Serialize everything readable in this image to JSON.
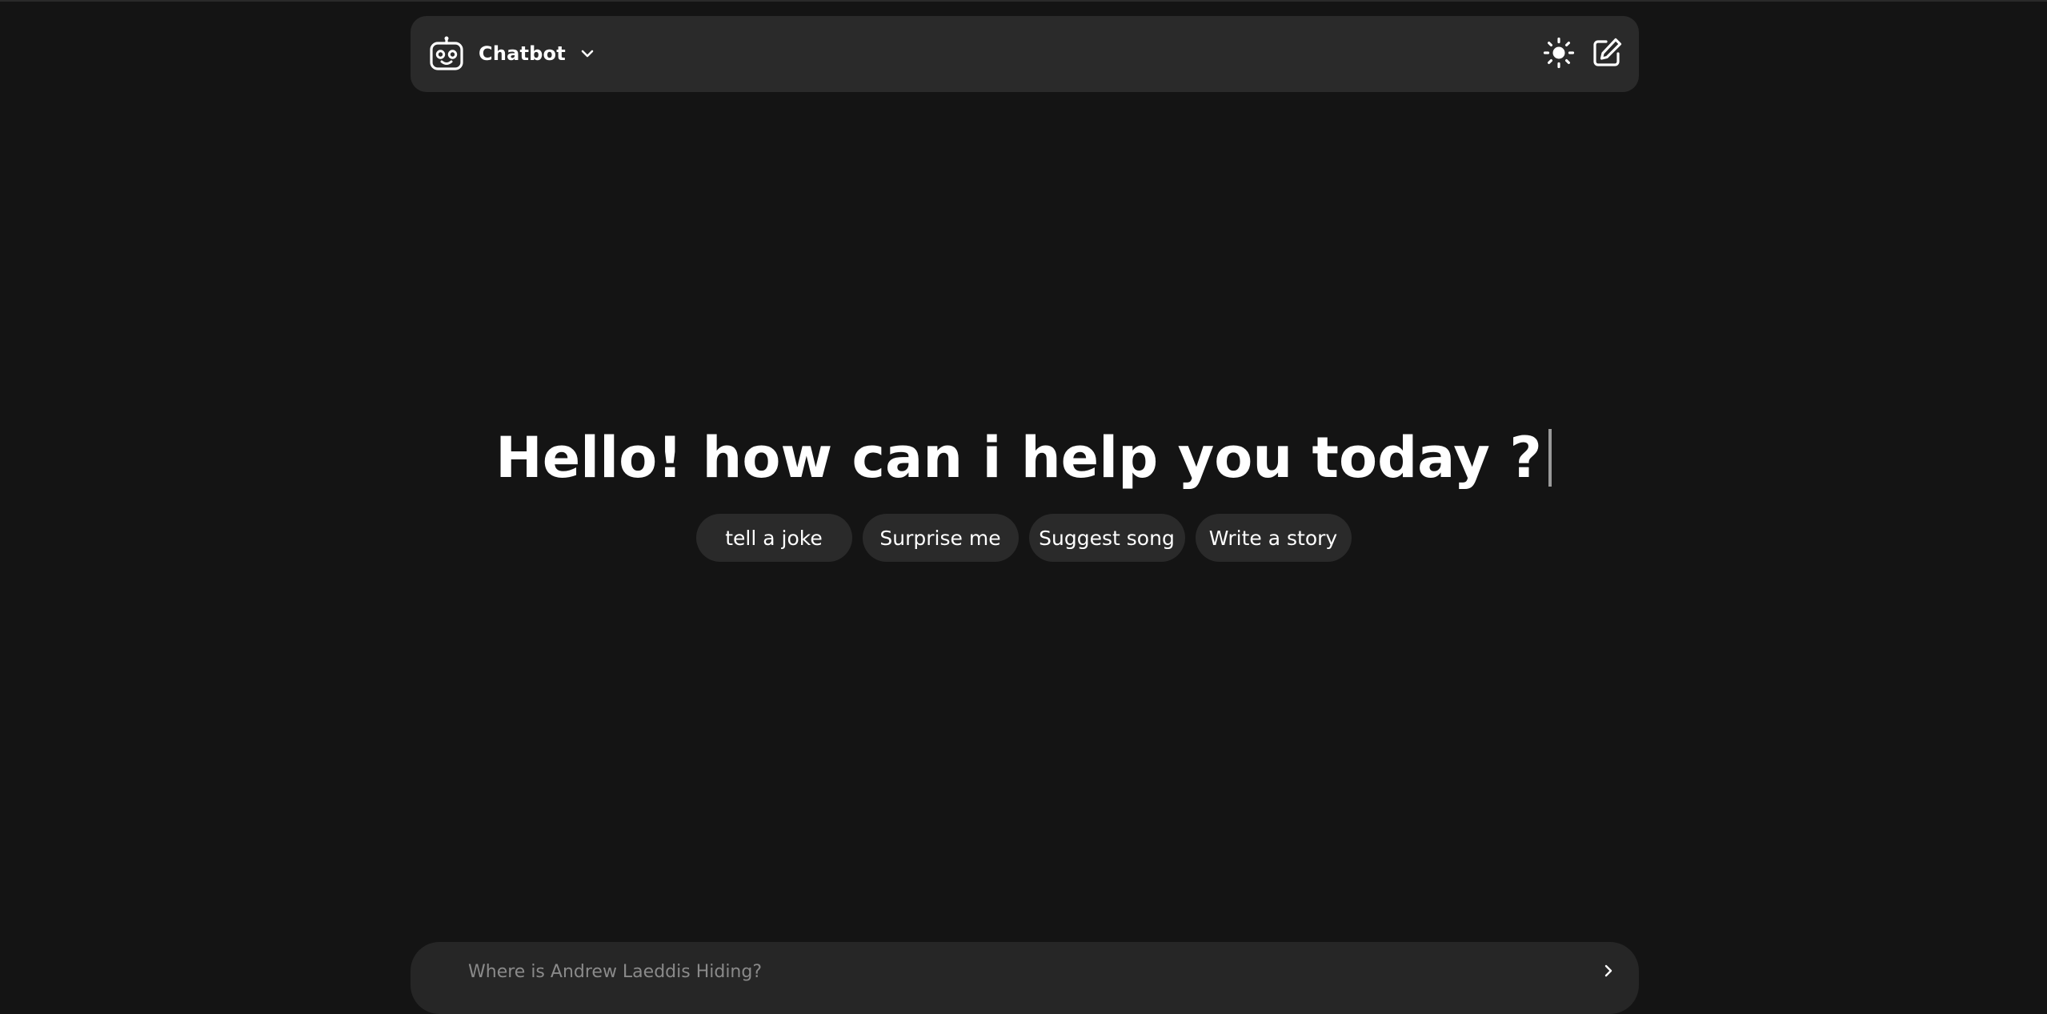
{
  "header": {
    "app_name": "Chatbot",
    "icons": {
      "logo": "robot-icon",
      "dropdown": "chevron-down-icon",
      "theme": "sun-icon",
      "new_chat": "edit-icon"
    }
  },
  "main": {
    "greeting": "Hello! how can i help you today ?",
    "suggestions": [
      {
        "label": "tell a joke"
      },
      {
        "label": "Surprise me"
      },
      {
        "label": "Suggest song"
      },
      {
        "label": "Write a story"
      }
    ]
  },
  "composer": {
    "placeholder": "Where is Andrew Laeddis Hiding?",
    "value": "",
    "send_icon": "chevron-right-icon"
  },
  "colors": {
    "background": "#141414",
    "surface": "#2a2a2a",
    "text": "#ffffff",
    "placeholder": "#8a8a8a"
  }
}
